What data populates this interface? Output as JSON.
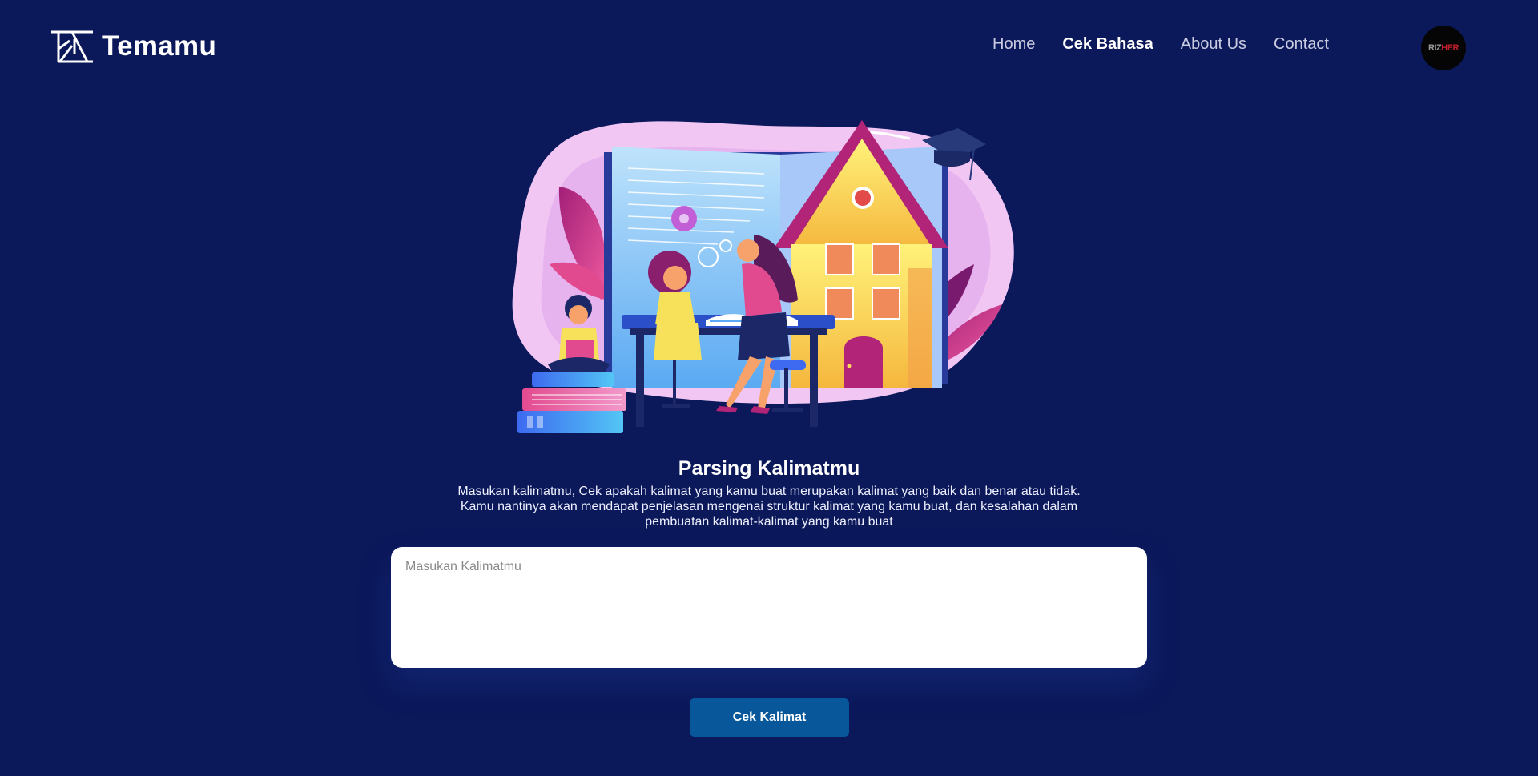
{
  "brand": {
    "name": "Temamu",
    "icon": "temamu-logo-icon"
  },
  "nav": {
    "items": [
      {
        "label": "Home",
        "active": false
      },
      {
        "label": "Cek Bahasa",
        "active": true
      },
      {
        "label": "About Us",
        "active": false
      },
      {
        "label": "Contact",
        "active": false
      }
    ]
  },
  "avatar": {
    "text_part1": "RIZ",
    "text_part2": "HER"
  },
  "hero": {
    "icon": "education-illustration"
  },
  "main": {
    "title": "Parsing Kalimatmu",
    "description": "Masukan kalimatmu, Cek apakah kalimat yang kamu buat merupakan kalimat yang baik dan benar atau tidak. Kamu nantinya akan mendapat penjelasan mengenai struktur kalimat yang kamu buat, dan kesalahan dalam pembuatan kalimat-kalimat yang kamu buat",
    "input_placeholder": "Masukan Kalimatmu",
    "input_value": "",
    "button_label": "Cek Kalimat"
  },
  "colors": {
    "background": "#0b185a",
    "button": "#07579a",
    "text": "#ffffff"
  }
}
